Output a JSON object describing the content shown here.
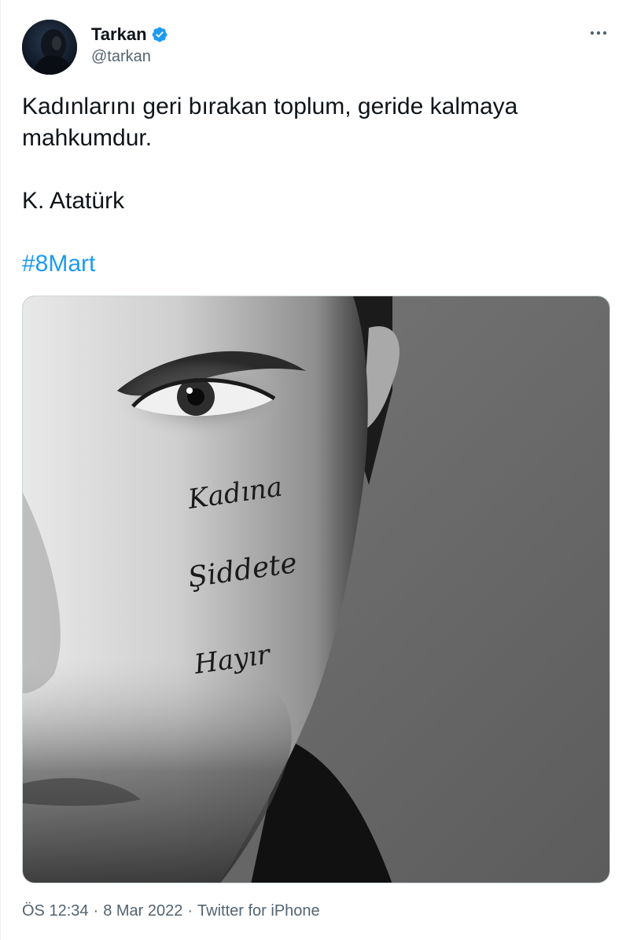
{
  "author": {
    "display_name": "Tarkan",
    "handle": "@tarkan",
    "verified": true,
    "avatar_icon": "profile-photo"
  },
  "tweet": {
    "line1": "Kadınlarını geri bırakan toplum, geride kalmaya mahkumdur.",
    "attribution": "K. Atatürk",
    "hashtag": "#8Mart"
  },
  "media": {
    "image_overlay_text": [
      "Kadına",
      "Şiddete",
      "Hayır"
    ]
  },
  "meta": {
    "time": "ÖS 12:34",
    "separator1": "·",
    "date": "8 Mar 2022",
    "separator2": "·",
    "source": "Twitter for iPhone"
  },
  "colors": {
    "accent": "#1d9bf0",
    "secondary_text": "#536471",
    "border": "#cfd9de"
  }
}
